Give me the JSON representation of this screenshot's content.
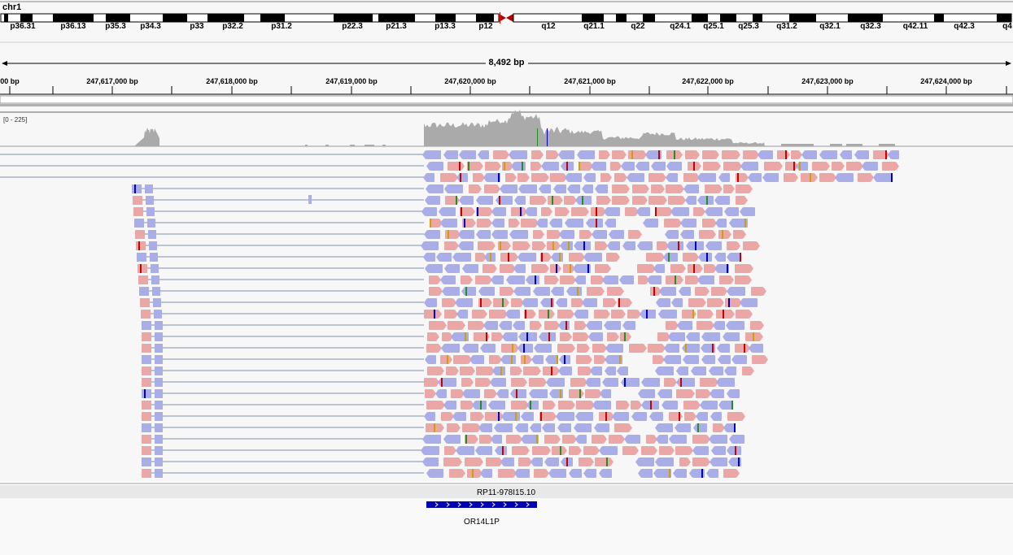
{
  "chromosome": "chr1",
  "ideogram": {
    "bands": [
      {
        "label": "p36.31",
        "center": 28
      },
      {
        "label": "p36.13",
        "center": 90
      },
      {
        "label": "p35.3",
        "center": 142
      },
      {
        "label": "p34.3",
        "center": 185
      },
      {
        "label": "p33",
        "center": 242
      },
      {
        "label": "p32.2",
        "center": 286
      },
      {
        "label": "p31.2",
        "center": 346
      },
      {
        "label": "p22.3",
        "center": 433
      },
      {
        "label": "p21.3",
        "center": 487
      },
      {
        "label": "p13.3",
        "center": 547
      },
      {
        "label": "p12",
        "center": 597
      },
      {
        "label": "q12",
        "center": 674
      },
      {
        "label": "q21.1",
        "center": 730
      },
      {
        "label": "q22",
        "center": 784
      },
      {
        "label": "q24.1",
        "center": 836
      },
      {
        "label": "q25.1",
        "center": 877
      },
      {
        "label": "q25.3",
        "center": 920
      },
      {
        "label": "q31.2",
        "center": 967
      },
      {
        "label": "q32.1",
        "center": 1020
      },
      {
        "label": "q32.3",
        "center": 1070
      },
      {
        "label": "q42.11",
        "center": 1125
      },
      {
        "label": "q42.3",
        "center": 1185
      },
      {
        "label": "q4",
        "center": 1238
      }
    ]
  },
  "ruler": {
    "span_label": "8,492 bp",
    "ticks": [
      {
        "label": "00 bp"
      },
      {
        "label": "247,617,000 bp"
      },
      {
        "label": "247,618,000 bp"
      },
      {
        "label": "247,619,000 bp"
      },
      {
        "label": "247,620,000 bp"
      },
      {
        "label": "247,621,000 bp"
      },
      {
        "label": "247,622,000 bp"
      },
      {
        "label": "247,623,000 bp"
      },
      {
        "label": "247,624,000 bp"
      }
    ]
  },
  "coverage": {
    "range_label": "[0 - 225]"
  },
  "genes": {
    "top_name": "RP11-978I15.10",
    "bottom_name": "OR14L1P"
  },
  "colors": {
    "read_forward": "#eba6a6",
    "read_reverse": "#a9aee8",
    "coverage": "#aaaaaa",
    "gene": "#0000b2",
    "mismatch_t": "#cc0000",
    "mismatch_g": "#209020",
    "mismatch_c": "#0000cc",
    "mismatch_a": "#d0a000"
  }
}
